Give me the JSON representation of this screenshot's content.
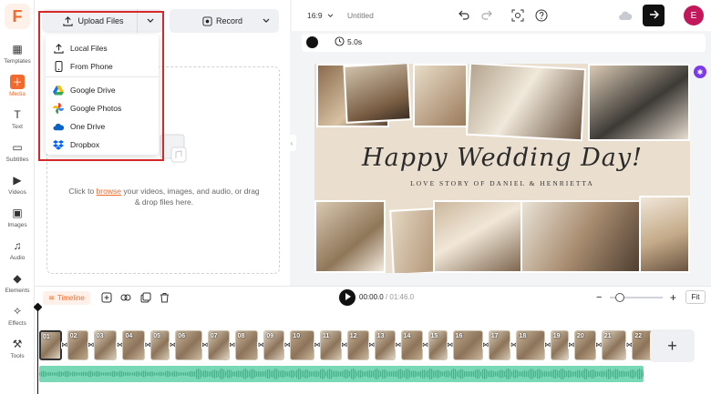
{
  "app": {
    "logo_letter": "F",
    "accent": "#f26b2c"
  },
  "rail": {
    "items": [
      {
        "label": "Templates",
        "icon": "templates-icon"
      },
      {
        "label": "Media",
        "icon": "media-icon",
        "active": true
      },
      {
        "label": "Text",
        "icon": "text-icon"
      },
      {
        "label": "Subtitles",
        "icon": "subtitles-icon"
      },
      {
        "label": "Videos",
        "icon": "videos-icon"
      },
      {
        "label": "Images",
        "icon": "images-icon"
      },
      {
        "label": "Audio",
        "icon": "audio-icon"
      },
      {
        "label": "Elements",
        "icon": "elements-icon"
      },
      {
        "label": "Effects",
        "icon": "effects-icon"
      },
      {
        "label": "Tools",
        "icon": "tools-icon"
      }
    ]
  },
  "panel": {
    "upload_label": "Upload Files",
    "record_label": "Record",
    "drop_text_before": "Click to ",
    "drop_link": "browse",
    "drop_text_after": " your videos, images, and audio, or drag & drop files here."
  },
  "dropdown": {
    "items": [
      {
        "label": "Local Files",
        "icon": "upload-icon"
      },
      {
        "label": "From Phone",
        "icon": "phone-icon"
      },
      {
        "label": "Google Drive",
        "icon": "google-drive-icon"
      },
      {
        "label": "Google Photos",
        "icon": "google-photos-icon"
      },
      {
        "label": "One Drive",
        "icon": "onedrive-icon"
      },
      {
        "label": "Dropbox",
        "icon": "dropbox-icon"
      }
    ]
  },
  "topbar": {
    "aspect": "16:9",
    "project_name": "Untitled",
    "avatar_letter": "E"
  },
  "subbar": {
    "duration": "5.0s"
  },
  "canvas": {
    "title": "Happy Wedding Day!",
    "subtitle": "LOVE STORY OF DANIEL & HENRIETTA"
  },
  "timeline": {
    "label": "Timeline",
    "current_time": "00:00.0",
    "total_time": "01:46.0",
    "fit_label": "Fit",
    "add_label": "+",
    "clip_numbers": [
      "01",
      "02",
      "03",
      "04",
      "05",
      "06",
      "07",
      "08",
      "09",
      "10",
      "11",
      "12",
      "13",
      "14",
      "15",
      "16",
      "17",
      "18",
      "19",
      "20",
      "21",
      "22"
    ]
  }
}
